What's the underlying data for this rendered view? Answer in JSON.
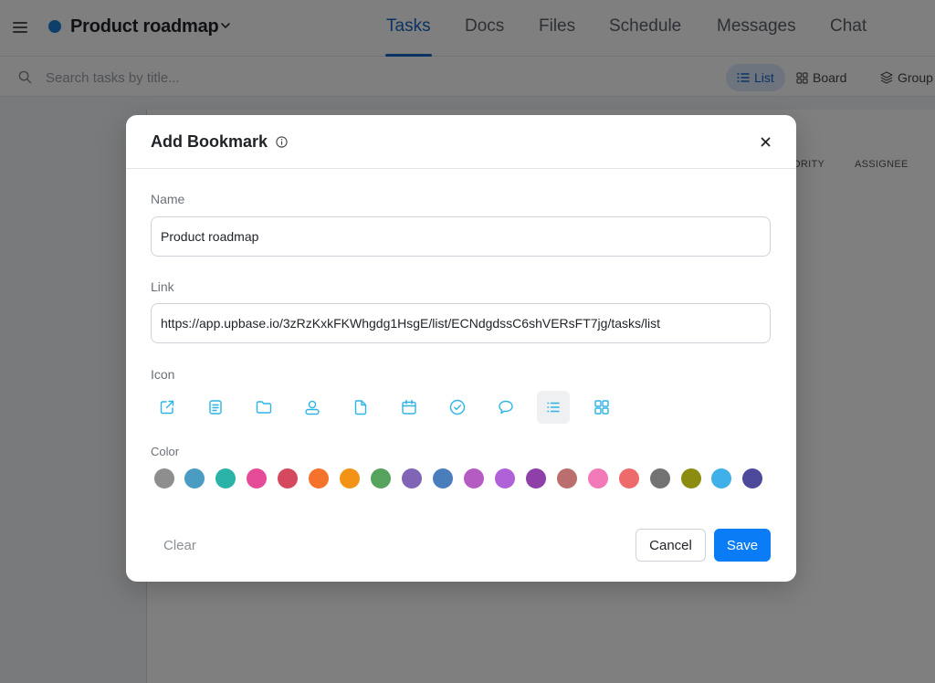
{
  "header": {
    "project_title": "Product roadmap",
    "project_dot_color": "#1c7fd4",
    "tabs": [
      {
        "label": "Tasks",
        "active": true
      },
      {
        "label": "Docs",
        "active": false
      },
      {
        "label": "Files",
        "active": false
      },
      {
        "label": "Schedule",
        "active": false
      },
      {
        "label": "Messages",
        "active": false
      },
      {
        "label": "Chat",
        "active": false
      }
    ]
  },
  "toolbar": {
    "search_placeholder": "Search tasks by title...",
    "list_label": "List",
    "board_label": "Board",
    "group_label": "Group"
  },
  "table": {
    "columns": [
      "ORITY",
      "ASSIGNEE"
    ]
  },
  "modal": {
    "title": "Add Bookmark",
    "name_label": "Name",
    "name_value": "Product roadmap",
    "link_label": "Link",
    "link_value": "https://app.upbase.io/3zRzKxkFKWhgdg1HsgE/list/ECNdgdssC6shVERsFT7jg/tasks/list",
    "icon_label": "Icon",
    "icons": [
      "external-link-icon",
      "document-list-icon",
      "folder-icon",
      "user-icon",
      "file-icon",
      "calendar-icon",
      "check-circle-icon",
      "chat-bubble-icon",
      "list-icon",
      "grid-icon"
    ],
    "selected_icon": "list-icon",
    "icon_color": "#2cb4e6",
    "color_label": "Color",
    "colors": [
      "#8e8e8e",
      "#4a9cc2",
      "#2bb3a8",
      "#e64b98",
      "#d5495e",
      "#f4722b",
      "#f29318",
      "#55a35c",
      "#8065b4",
      "#4a7dbc",
      "#b55cc2",
      "#b061d8",
      "#8e3fa8",
      "#bb6e6e",
      "#f27ab8",
      "#ee6b6b",
      "#727272",
      "#8c8c10",
      "#3fb0e8",
      "#4d4a9c"
    ],
    "clear_label": "Clear",
    "cancel_label": "Cancel",
    "save_label": "Save",
    "save_color": "#0a7cf5"
  }
}
